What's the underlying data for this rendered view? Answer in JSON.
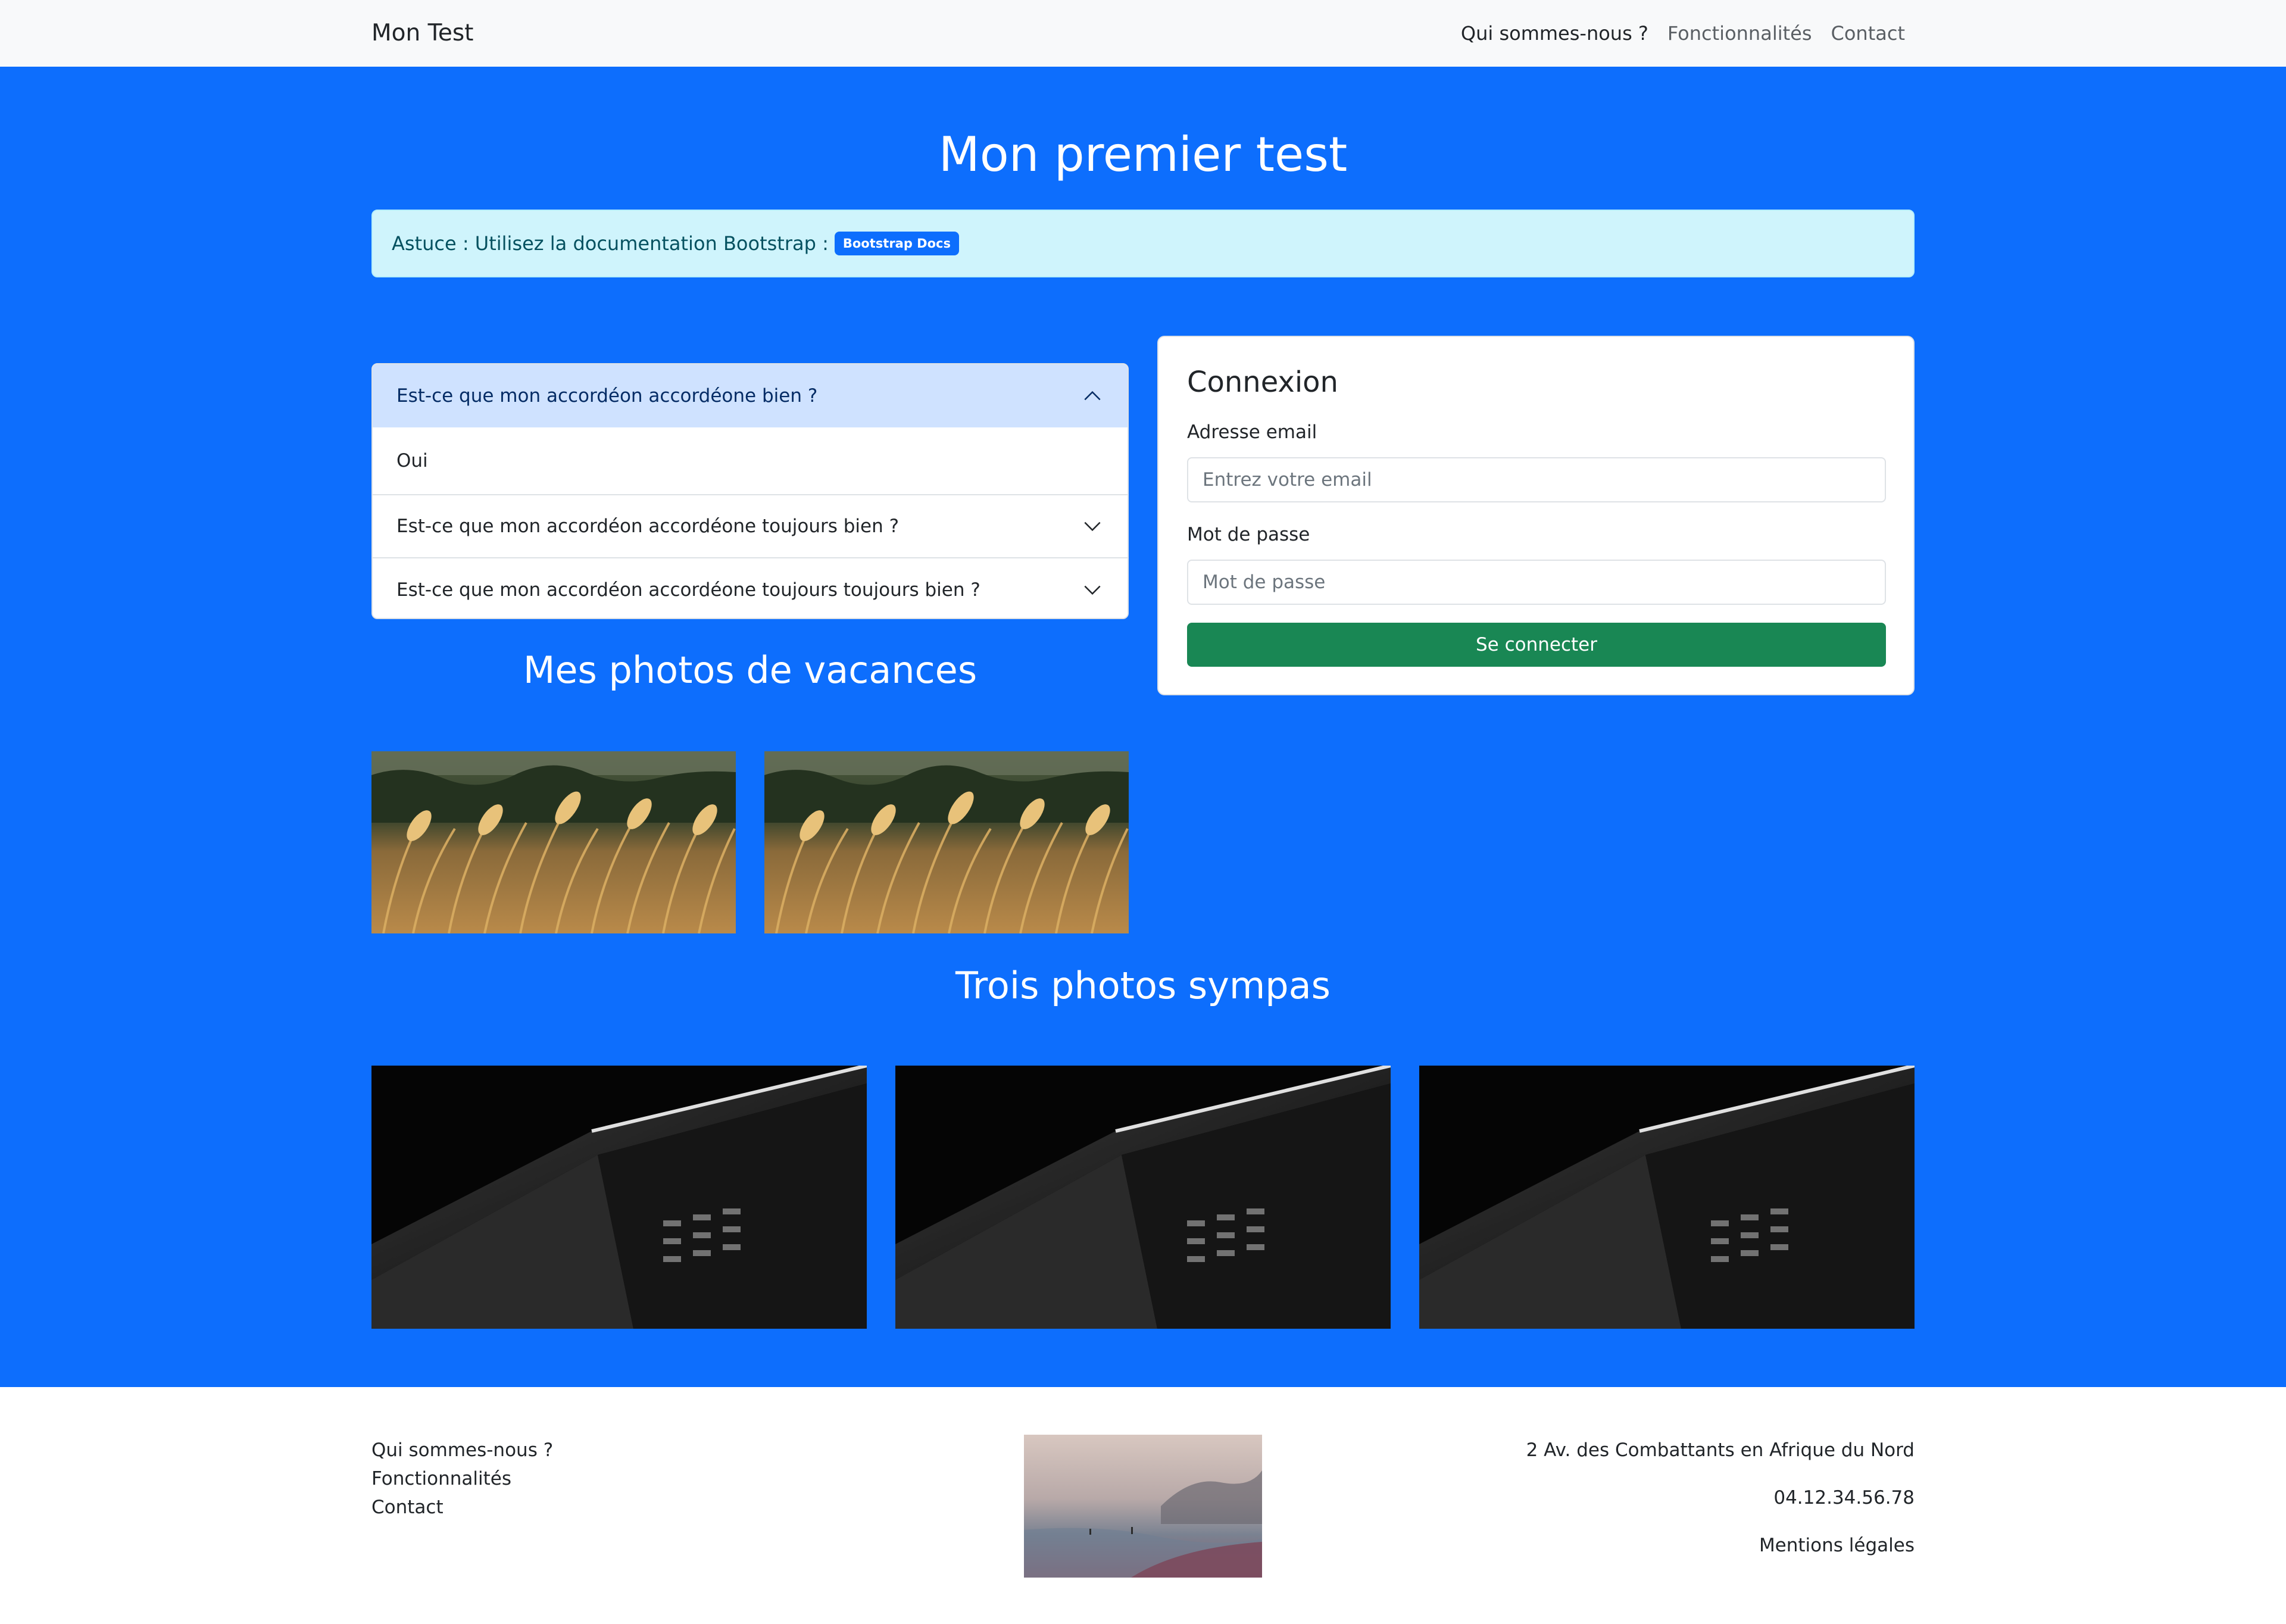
{
  "navbar": {
    "brand": "Mon Test",
    "links": [
      {
        "label": "Qui sommes-nous ?",
        "active": true
      },
      {
        "label": "Fonctionnalités",
        "active": false
      },
      {
        "label": "Contact",
        "active": false
      }
    ]
  },
  "hero": {
    "title": "Mon premier test",
    "alert_text": "Astuce : Utilisez la documentation Bootstrap :",
    "badge_label": "Bootstrap Docs"
  },
  "accordion": [
    {
      "question": "Est-ce que mon accordéon accordéone bien ?",
      "answer": "Oui",
      "open": true
    },
    {
      "question": "Est-ce que mon accordéon accordéone toujours bien ?",
      "open": false
    },
    {
      "question": "Est-ce que mon accordéon accordéone toujours toujours bien ?",
      "open": false
    }
  ],
  "login": {
    "title": "Connexion",
    "email_label": "Adresse email",
    "email_placeholder": "Entrez votre email",
    "password_label": "Mot de passe",
    "password_placeholder": "Mot de passe",
    "submit_label": "Se connecter"
  },
  "sections": {
    "vacances_title": "Mes photos de vacances",
    "trois_title": "Trois photos sympas"
  },
  "footer": {
    "links": [
      "Qui sommes-nous ?",
      "Fonctionnalités",
      "Contact"
    ],
    "address": "2 Av. des Combattants en Afrique du Nord",
    "phone": "04.12.34.56.78",
    "legal": "Mentions légales"
  },
  "colors": {
    "primary": "#0d6efd",
    "success": "#198754",
    "alert_bg": "#cff4fc",
    "accordion_active_bg": "#cfe2ff"
  }
}
